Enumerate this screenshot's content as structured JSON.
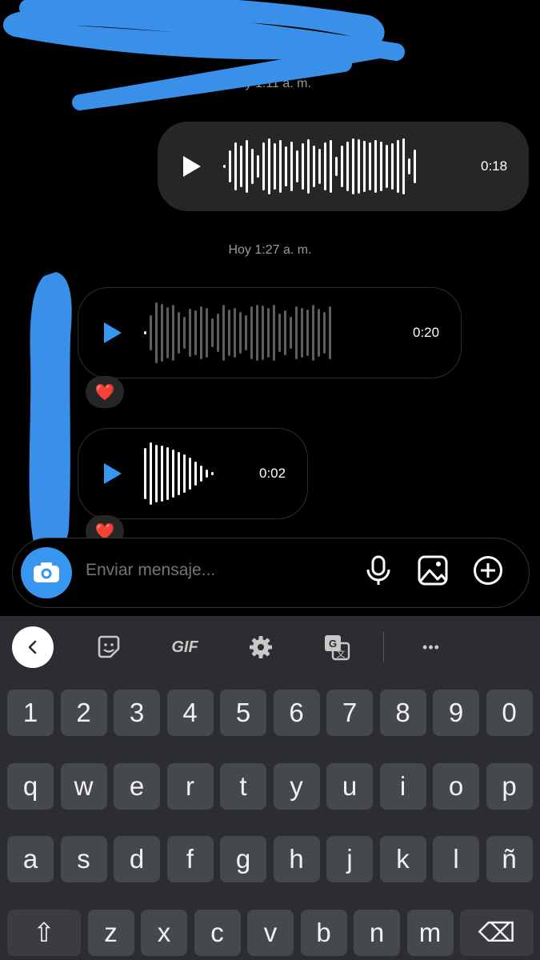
{
  "conversation": {
    "timestamp_1": "Hoy 1:11 a. m.",
    "timestamp_2": "Hoy 1:27 a. m.",
    "messages": [
      {
        "direction": "sent",
        "type": "voice",
        "duration": "0:18"
      },
      {
        "direction": "received",
        "type": "voice",
        "duration": "0:20",
        "reaction": "❤️"
      },
      {
        "direction": "received",
        "type": "voice",
        "duration": "0:02",
        "reaction": "❤️"
      }
    ]
  },
  "composer": {
    "placeholder": "Enviar mensaje...",
    "icons": [
      "camera-icon",
      "microphone-icon",
      "image-icon",
      "plus-circle-icon"
    ]
  },
  "keyboard": {
    "toolbar": {
      "gif_label": "GIF",
      "more_label": "•••",
      "icons": [
        "back-chevron-icon",
        "sticker-icon",
        "settings-icon",
        "translate-icon"
      ]
    },
    "rows": [
      [
        "1",
        "2",
        "3",
        "4",
        "5",
        "6",
        "7",
        "8",
        "9",
        "0"
      ],
      [
        "q",
        "w",
        "e",
        "r",
        "t",
        "y",
        "u",
        "i",
        "o",
        "p"
      ],
      [
        "a",
        "s",
        "d",
        "f",
        "g",
        "h",
        "j",
        "k",
        "l",
        "ñ"
      ],
      [
        "⇧",
        "z",
        "x",
        "c",
        "v",
        "b",
        "n",
        "m",
        "⌫"
      ]
    ]
  },
  "colors": {
    "accent": "#3797f0",
    "sent_bubble": "#262626",
    "keyboard_bg": "#2b2d30",
    "key_bg": "#45484d",
    "reaction_heart": "#ff3040",
    "redaction_scribble": "#3a8fe8"
  }
}
